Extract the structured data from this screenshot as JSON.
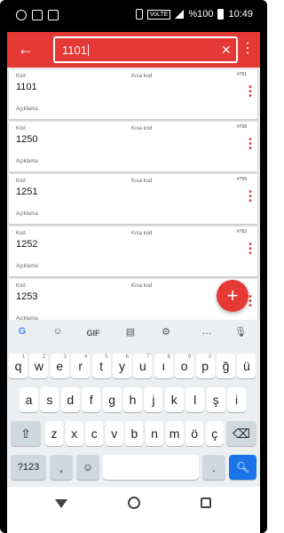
{
  "status_bar": {
    "network": "VoLTE",
    "battery": "%100",
    "time": "10:49",
    "icons": [
      "whatsapp-icon",
      "screen-record-icon",
      "ai-icon",
      "vibrate-icon",
      "signal-icon",
      "battery-icon"
    ]
  },
  "app_bar": {
    "back_icon": "arrow-left-icon",
    "search_value": "1101",
    "clear_icon": "close-icon",
    "menu_icon": "more-vert-icon",
    "accent": "#e53935"
  },
  "list": {
    "labels": {
      "kod": "Kod",
      "kisa_kod": "Kısa kod",
      "aciklama": "Açıklama"
    },
    "items": [
      {
        "code": "1101",
        "num": "#781"
      },
      {
        "code": "1250",
        "num": "#798"
      },
      {
        "code": "1251",
        "num": "#799"
      },
      {
        "code": "1252",
        "num": "#783"
      },
      {
        "code": "1253",
        "num": ""
      }
    ]
  },
  "fab": {
    "label": "+"
  },
  "keyboard": {
    "toolbar": [
      "G",
      "sticker-icon",
      "GIF",
      "clipboard-icon",
      "gear-icon",
      "...",
      "mic-icon"
    ],
    "gif_label": "GIF",
    "row1": [
      {
        "k": "q",
        "n": "1"
      },
      {
        "k": "w",
        "n": "2"
      },
      {
        "k": "e",
        "n": "3"
      },
      {
        "k": "r",
        "n": "4"
      },
      {
        "k": "t",
        "n": "5"
      },
      {
        "k": "y",
        "n": "6"
      },
      {
        "k": "u",
        "n": "7"
      },
      {
        "k": "ı",
        "n": "8"
      },
      {
        "k": "o",
        "n": "9"
      },
      {
        "k": "p",
        "n": "0"
      },
      {
        "k": "ğ",
        "n": ""
      },
      {
        "k": "ü",
        "n": ""
      }
    ],
    "row2": [
      "a",
      "s",
      "d",
      "f",
      "g",
      "h",
      "j",
      "k",
      "l",
      "ş",
      "i"
    ],
    "row3": [
      "z",
      "x",
      "c",
      "v",
      "b",
      "n",
      "m",
      "ö",
      "ç"
    ],
    "symbols_label": "?123",
    "comma": ",",
    "period": ".",
    "colors": {
      "bg": "#eceff1",
      "search_key": "#1a73e8"
    }
  }
}
